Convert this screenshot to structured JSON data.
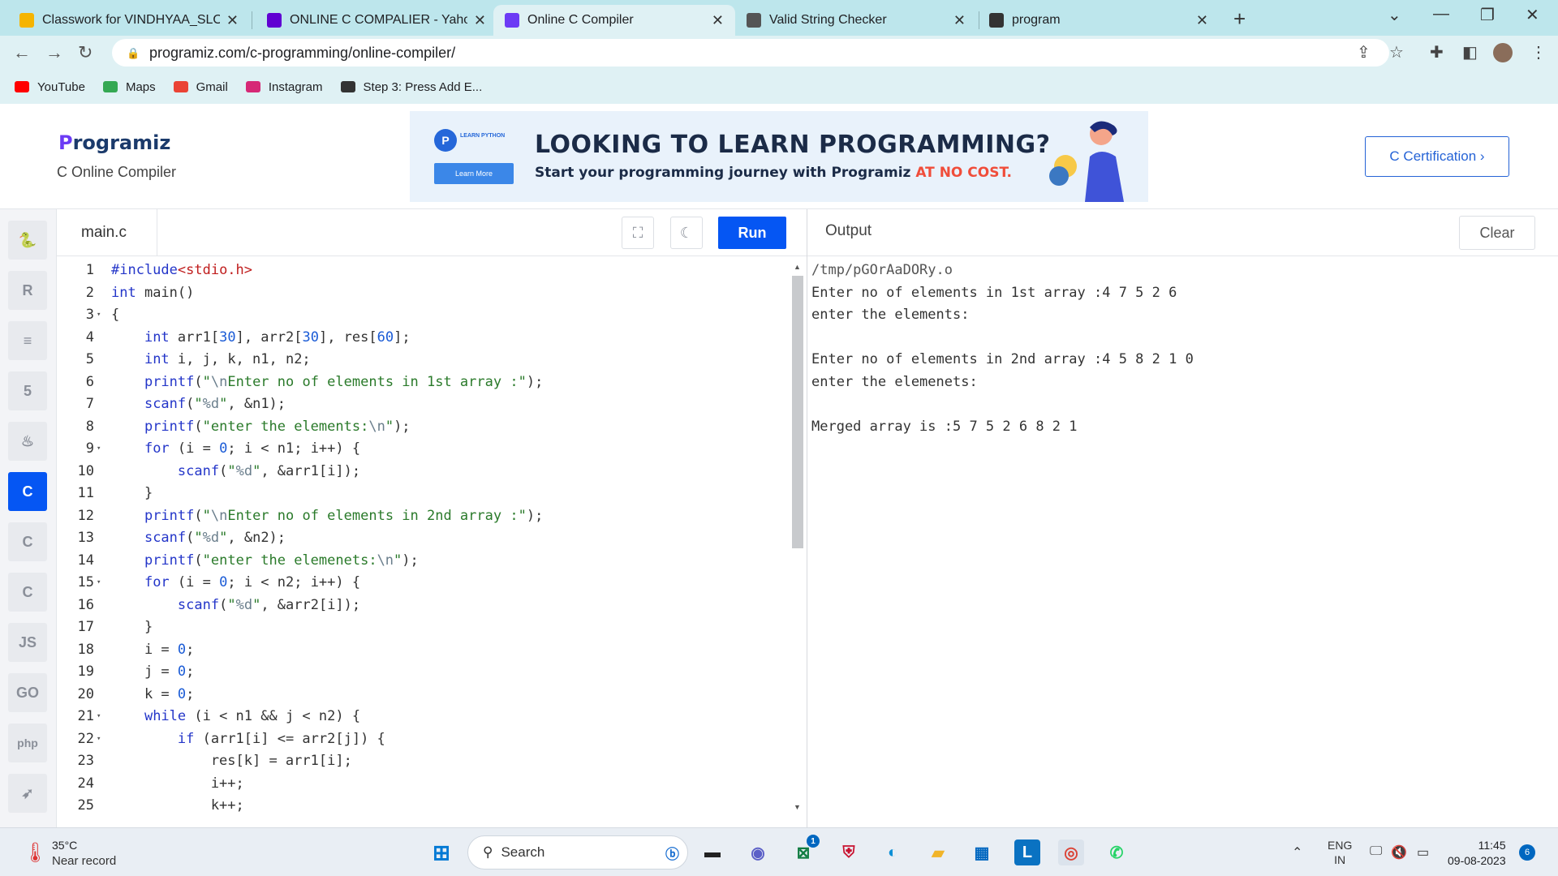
{
  "browser": {
    "tabs": [
      {
        "title": "Classwork for VINDHYAA_SLOT B",
        "icon": "classroom-icon",
        "color": "#f5b400"
      },
      {
        "title": "ONLINE C COMPALIER - Yahoo Ir",
        "icon": "yahoo-icon",
        "color": "#6001d2"
      },
      {
        "title": "Online C Compiler",
        "icon": "programiz-icon",
        "color": "#6c3bf5"
      },
      {
        "title": "Valid String Checker",
        "icon": "openai-icon",
        "color": "#555555"
      },
      {
        "title": "program",
        "icon": "globe-icon",
        "color": "#333333"
      }
    ],
    "url": "programiz.com/c-programming/online-compiler/",
    "bookmarks": [
      {
        "label": "YouTube",
        "icon": "youtube-icon",
        "color": "#ff0000"
      },
      {
        "label": "Maps",
        "icon": "maps-icon",
        "color": "#34a853"
      },
      {
        "label": "Gmail",
        "icon": "gmail-icon",
        "color": "#ea4335"
      },
      {
        "label": "Instagram",
        "icon": "instagram-icon",
        "color": "#d62976"
      },
      {
        "label": "Step 3: Press Add E...",
        "icon": "globe-icon",
        "color": "#333333"
      }
    ]
  },
  "site": {
    "logo": "Programiz",
    "subtitle": "C Online Compiler",
    "banner": {
      "badge": "LEARN PYTHON",
      "button": "Learn More",
      "headline": "LOOKING TO LEARN PROGRAMMING?",
      "sub_prefix": "Start your programming journey with Programiz ",
      "sub_highlight": "AT NO COST."
    },
    "cert_button": "C Certification ›"
  },
  "sidebar": {
    "items": [
      {
        "name": "python",
        "icon": "python-icon",
        "glyph": "🐍"
      },
      {
        "name": "r",
        "icon": "r-icon",
        "glyph": "R"
      },
      {
        "name": "sql",
        "icon": "database-icon",
        "glyph": "≡"
      },
      {
        "name": "html",
        "icon": "html5-icon",
        "glyph": "5"
      },
      {
        "name": "java",
        "icon": "java-icon",
        "glyph": "♨"
      },
      {
        "name": "c",
        "icon": "c-icon",
        "glyph": "C",
        "active": true
      },
      {
        "name": "cpp",
        "icon": "cpp-icon",
        "glyph": "C"
      },
      {
        "name": "csharp",
        "icon": "csharp-icon",
        "glyph": "C"
      },
      {
        "name": "js",
        "icon": "javascript-icon",
        "glyph": "JS"
      },
      {
        "name": "go",
        "icon": "go-icon",
        "glyph": "GO"
      },
      {
        "name": "php",
        "icon": "php-icon",
        "glyph": "php"
      },
      {
        "name": "swift",
        "icon": "swift-icon",
        "glyph": "➶"
      }
    ]
  },
  "editor": {
    "filename": "main.c",
    "run_label": "Run",
    "lines": [
      "#include<stdio.h>",
      "int main()",
      "{",
      "    int arr1[30], arr2[30], res[60];",
      "    int i, j, k, n1, n2;",
      "    printf(\"\\nEnter no of elements in 1st array :\");",
      "    scanf(\"%d\", &n1);",
      "    printf(\"enter the elements:\\n\");",
      "    for (i = 0; i < n1; i++) {",
      "        scanf(\"%d\", &arr1[i]);",
      "    }",
      "    printf(\"\\nEnter no of elements in 2nd array :\");",
      "    scanf(\"%d\", &n2);",
      "    printf(\"enter the elemenets:\\n\");",
      "    for (i = 0; i < n2; i++) {",
      "        scanf(\"%d\", &arr2[i]);",
      "    }",
      "    i = 0;",
      "    j = 0;",
      "    k = 0;",
      "    while (i < n1 && j < n2) {",
      "        if (arr1[i] <= arr2[j]) {",
      "            res[k] = arr1[i];",
      "            i++;",
      "            k++;"
    ],
    "fold_lines": [
      3,
      9,
      15,
      21,
      22
    ]
  },
  "output": {
    "title": "Output",
    "clear_label": "Clear",
    "lines": [
      "/tmp/pGOrAaDORy.o",
      "Enter no of elements in 1st array :4 7 5 2 6",
      "enter the elements:",
      "",
      "Enter no of elements in 2nd array :4 5 8 2 1 0",
      "enter the elemenets:",
      "",
      "Merged array is :5 7 5 2 6 8 2 1"
    ]
  },
  "taskbar": {
    "weather_temp": "35°C",
    "weather_cond": "Near record",
    "search_placeholder": "Search",
    "lang": "ENG",
    "region": "IN",
    "time": "11:45",
    "date": "09-08-2023",
    "notifications": "6",
    "teams_badge": "1"
  }
}
